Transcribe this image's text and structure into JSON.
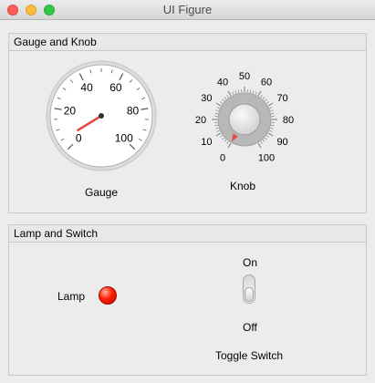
{
  "window": {
    "title": "UI Figure"
  },
  "panel1": {
    "title": "Gauge and Knob",
    "gauge": {
      "label": "Gauge",
      "value": 5,
      "min": 0,
      "max": 100,
      "ticks": [
        "0",
        "20",
        "40",
        "60",
        "80",
        "100"
      ],
      "needle_color": "#e8453c"
    },
    "knob": {
      "label": "Knob",
      "value": 0,
      "min": 0,
      "max": 100,
      "ticks": [
        "0",
        "10",
        "20",
        "30",
        "40",
        "50",
        "60",
        "70",
        "80",
        "90",
        "100"
      ],
      "indicator_color": "#e8453c"
    }
  },
  "panel2": {
    "title": "Lamp and Switch",
    "lamp": {
      "label": "Lamp",
      "color": "#ff1a00",
      "state": "on"
    },
    "toggle": {
      "label": "Toggle Switch",
      "on_label": "On",
      "off_label": "Off",
      "state": "Off"
    }
  }
}
